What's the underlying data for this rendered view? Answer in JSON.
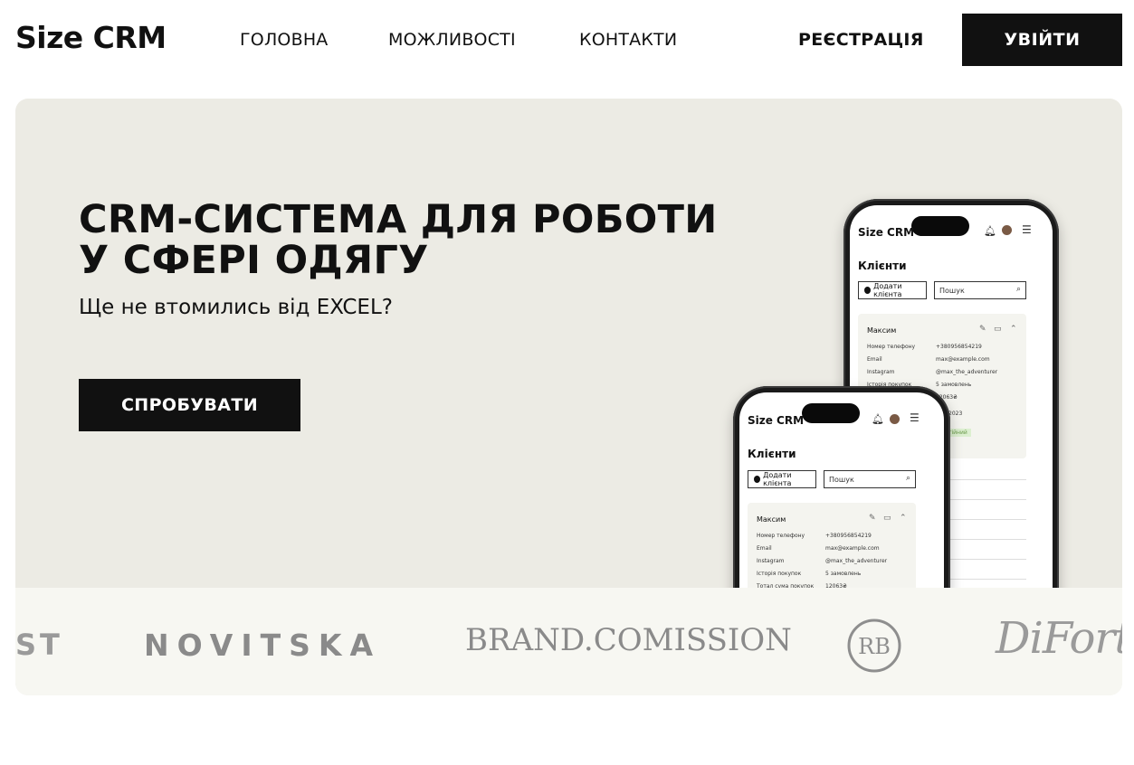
{
  "header": {
    "logo": "Size CRM",
    "nav": [
      "ГОЛОВНА",
      "МОЖЛИВОСТІ",
      "КОНТАКТИ"
    ],
    "register": "РЕЄСТРАЦІЯ",
    "login": "УВІЙТИ"
  },
  "hero": {
    "title_line1": "CRM-СИСТЕМА ДЛЯ РОБОТИ",
    "title_line2": "У СФЕРІ ОДЯГУ",
    "subtitle": "Ще не втомились від EXCEL?",
    "cta": "СПРОБУВАТИ"
  },
  "phone_mockup": {
    "logo": "Size CRM",
    "page_title": "Клієнти",
    "add_button": "Додати клієнта",
    "search_placeholder": "Пошук",
    "client": {
      "name": "Максим",
      "fields": [
        {
          "label": "Номер телефону",
          "value": "+380956854219"
        },
        {
          "label": "Email",
          "value": "max@example.com"
        },
        {
          "label": "Instagram",
          "value": "@max_the_adventurer"
        },
        {
          "label": "Історія покупок",
          "value": "5 замовлень"
        },
        {
          "label": "Тотал сума покупок",
          "value": "12063₴"
        }
      ]
    },
    "back_partial": {
      "purchase_total": "12063₴",
      "date_fragment": "2023",
      "status_fragment": "тійний"
    }
  },
  "brands": {
    "st": "ST",
    "novitska": "NOVITSKA",
    "brand_comission": "BRAND.COMISSION",
    "rb": "RB",
    "diforte": "DiForte"
  }
}
